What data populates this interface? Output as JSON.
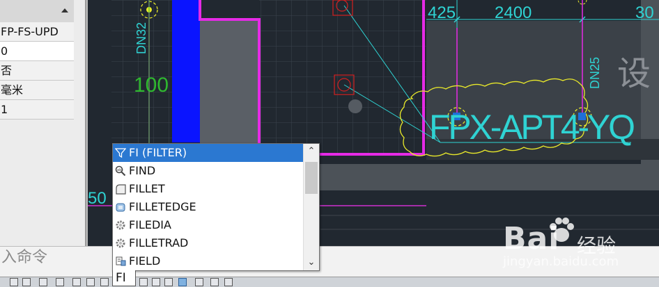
{
  "properties_panel": {
    "rows": [
      "FP-FS-UPD",
      "0",
      "否",
      "毫米",
      "1"
    ]
  },
  "drawing": {
    "texts": {
      "dn32": "DN32",
      "dn25": "DN25",
      "label_100": "100",
      "label_50": "50",
      "dim_425": "425",
      "dim_2400": "2400",
      "dim_30": "30",
      "tag": "FPX-APT4-YQ",
      "chinese_partial": "设"
    },
    "colors": {
      "background": "#212830",
      "magenta": "#e62ae6",
      "cyan": "#2fd3d3",
      "yellow": "#e8e82a",
      "red": "#d42020",
      "blue": "#0a14ff",
      "green": "#2fb82f"
    }
  },
  "autocomplete": {
    "items": [
      {
        "label": "FI (FILTER)",
        "icon": "filter-icon",
        "selected": true
      },
      {
        "label": "FIND",
        "icon": "find-icon",
        "selected": false
      },
      {
        "label": "FILLET",
        "icon": "fillet-icon",
        "selected": false
      },
      {
        "label": "FILLETEDGE",
        "icon": "filletedge-icon",
        "selected": false
      },
      {
        "label": "FILEDIA",
        "icon": "gear-icon",
        "selected": false
      },
      {
        "label": "FILLETRAD",
        "icon": "gear-icon",
        "selected": false
      },
      {
        "label": "FIELD",
        "icon": "field-icon",
        "selected": false
      }
    ]
  },
  "command_line": {
    "prompt": "入命令",
    "typed": "FI"
  },
  "watermark": {
    "brand": "Bai",
    "brand_suffix": "经验",
    "url": "jingyan.baidu.com"
  }
}
